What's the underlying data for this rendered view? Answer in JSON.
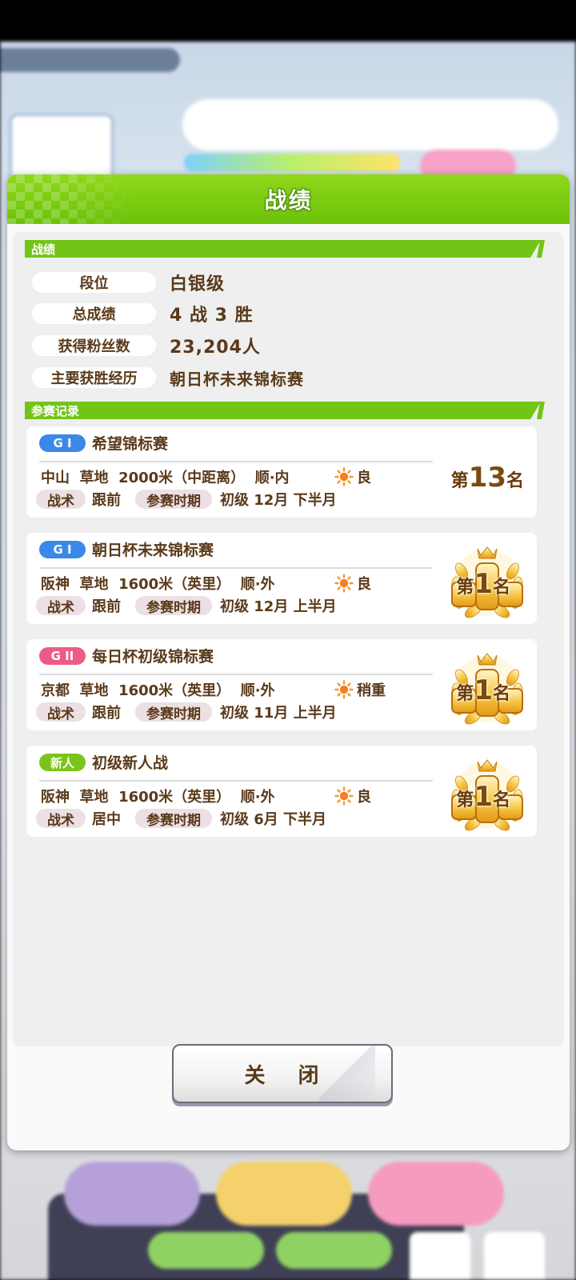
{
  "dialog": {
    "title": "战绩",
    "close_label": "关 闭"
  },
  "stats_section": {
    "heading": "战绩",
    "rows": [
      {
        "label": "段位",
        "value": "白银级"
      },
      {
        "label": "总成绩",
        "value": "4 战 3 胜"
      },
      {
        "label": "获得粉丝数",
        "value": "23,204人"
      },
      {
        "label": "主要获胜经历",
        "value": "朝日杯未来锦标赛"
      }
    ]
  },
  "records_section": {
    "heading": "参赛记录",
    "races": [
      {
        "grade": "G I",
        "grade_color": "#3a88e8",
        "name": "希望锦标赛",
        "info": "中山  草地  2000米（中距离）  顺·内",
        "weather": "良",
        "tactic_label": "战术",
        "tactic": "跟前",
        "period_label": "参赛时期",
        "period": "初级  12月  下半月",
        "rank_prefix": "第",
        "rank_num": "13",
        "rank_suffix": "名",
        "medal": false
      },
      {
        "grade": "G I",
        "grade_color": "#3a88e8",
        "name": "朝日杯未来锦标赛",
        "info": "阪神  草地  1600米（英里）  顺·外",
        "weather": "良",
        "tactic_label": "战术",
        "tactic": "跟前",
        "period_label": "参赛时期",
        "period": "初级  12月  上半月",
        "rank_prefix": "第",
        "rank_num": "1",
        "rank_suffix": "名",
        "medal": true
      },
      {
        "grade": "G II",
        "grade_color": "#ee5a86",
        "name": "每日杯初级锦标赛",
        "info": "京都  草地  1600米（英里）  顺·外",
        "weather": "稍重",
        "tactic_label": "战术",
        "tactic": "跟前",
        "period_label": "参赛时期",
        "period": "初级  11月  上半月",
        "rank_prefix": "第",
        "rank_num": "1",
        "rank_suffix": "名",
        "medal": true
      },
      {
        "grade": "新人",
        "grade_color": "#7cc41a",
        "name": "初级新人战",
        "info": "阪神  草地  1600米（英里）  顺·外",
        "weather": "良",
        "tactic_label": "战术",
        "tactic": "居中",
        "period_label": "参赛时期",
        "period": "初级  6月  下半月",
        "rank_prefix": "第",
        "rank_num": "1",
        "rank_suffix": "名",
        "medal": true
      }
    ]
  },
  "icons": {
    "weather": "sun-icon",
    "medal": "gold-laurel-medal-icon"
  }
}
